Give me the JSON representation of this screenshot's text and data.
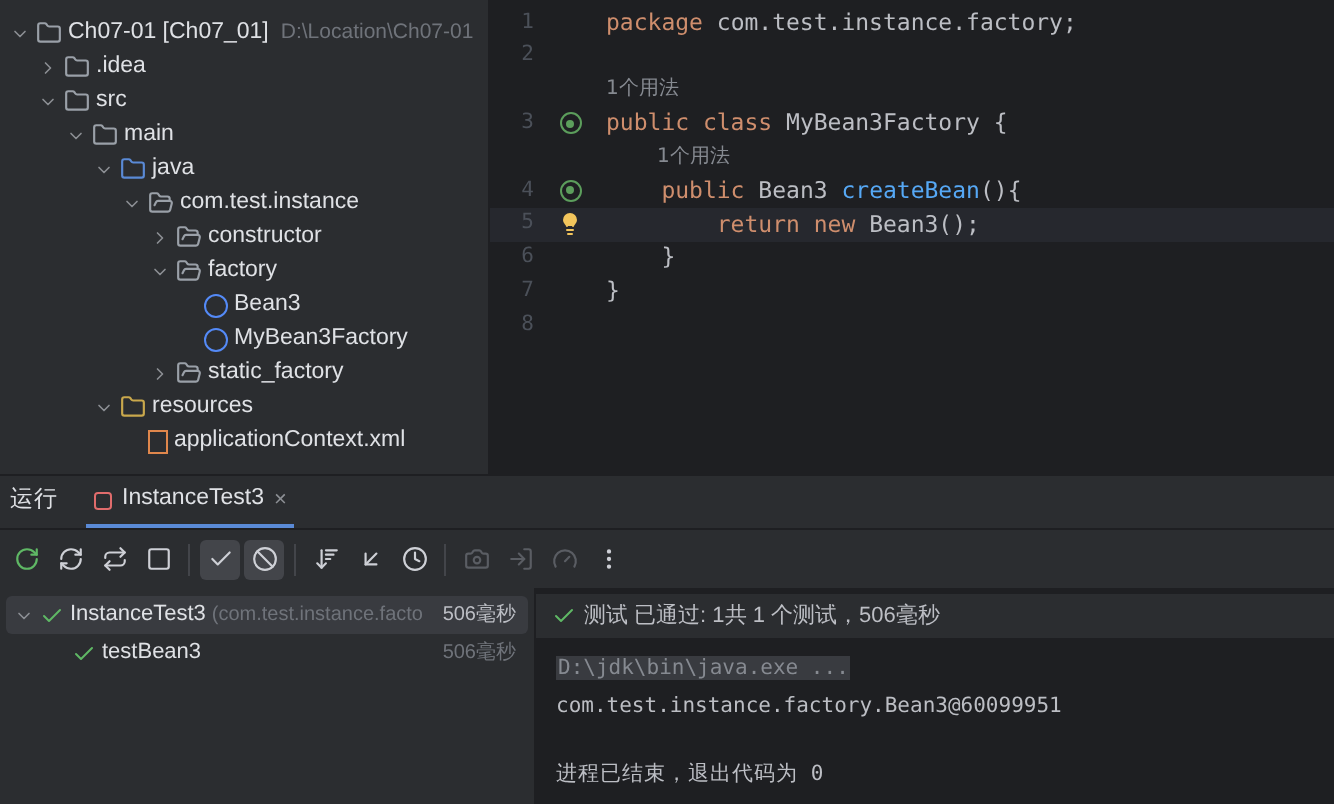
{
  "project_tree": {
    "items": [
      {
        "kind": "module",
        "label": "Ch07-01 [Ch07_01]",
        "path": "D:\\Location\\Ch07-01",
        "expanded": true,
        "children": [
          {
            "kind": "folder",
            "label": ".idea",
            "expanded": false
          },
          {
            "kind": "folder",
            "label": "src",
            "expanded": true,
            "children": [
              {
                "kind": "folder",
                "label": "main",
                "expanded": true,
                "children": [
                  {
                    "kind": "source",
                    "label": "java",
                    "expanded": true,
                    "children": [
                      {
                        "kind": "package",
                        "label": "com.test.instance",
                        "expanded": true,
                        "children": [
                          {
                            "kind": "package",
                            "label": "constructor",
                            "expanded": false
                          },
                          {
                            "kind": "package",
                            "label": "factory",
                            "expanded": true,
                            "children": [
                              {
                                "kind": "class",
                                "label": "Bean3"
                              },
                              {
                                "kind": "class",
                                "label": "MyBean3Factory"
                              }
                            ]
                          },
                          {
                            "kind": "package",
                            "label": "static_factory",
                            "expanded": false
                          }
                        ]
                      }
                    ]
                  },
                  {
                    "kind": "resources",
                    "label": "resources",
                    "expanded": true,
                    "children": [
                      {
                        "kind": "xml",
                        "label": "applicationContext.xml"
                      }
                    ]
                  }
                ]
              }
            ]
          }
        ]
      }
    ]
  },
  "editor": {
    "lines": [
      {
        "number": "1",
        "current": false,
        "tokens": [
          {
            "kind": "kw",
            "t": "package "
          },
          {
            "kind": "plain",
            "t": "com.test.instance.factory;"
          }
        ]
      },
      {
        "number": "2",
        "current": false
      },
      {
        "number": "3",
        "current": false,
        "hint": "1个用法",
        "gutter": {
          "kind": "bean"
        },
        "tokens": [
          {
            "kind": "kw",
            "t": "public class "
          },
          {
            "kind": "plain",
            "t": "MyBean3Factory {"
          }
        ]
      },
      {
        "number": "4",
        "current": false,
        "hint": "1个用法",
        "gutter": {
          "kind": "bean"
        },
        "tokens": [
          {
            "kind": "kw",
            "t": "    public "
          },
          {
            "kind": "plain",
            "t": "Bean3 "
          },
          {
            "kind": "method",
            "t": "createBean"
          },
          {
            "kind": "plain",
            "t": "(){"
          }
        ]
      },
      {
        "number": "5",
        "current": true,
        "gutter": {
          "kind": "bulb"
        },
        "tokens": [
          {
            "kind": "kw",
            "t": "        return new "
          },
          {
            "kind": "plain",
            "t": "Bean3();"
          }
        ]
      },
      {
        "number": "6",
        "current": false,
        "tokens": [
          {
            "kind": "plain",
            "t": "    }"
          }
        ]
      },
      {
        "number": "7",
        "current": false,
        "tokens": [
          {
            "kind": "plain",
            "t": "}"
          }
        ]
      },
      {
        "number": "8",
        "current": false
      }
    ]
  },
  "run_panel": {
    "title": "运行",
    "tabs": [
      {
        "label": "InstanceTest3",
        "selected": true,
        "close": "×"
      }
    ],
    "toolbar": [
      {
        "kind": "rerun",
        "on": false,
        "disabled": false
      },
      {
        "kind": "rerun-failed",
        "on": false,
        "disabled": false
      },
      {
        "kind": "auto-test",
        "on": false,
        "disabled": false
      },
      {
        "kind": "stop",
        "on": false,
        "disabled": false
      },
      {
        "kind": "sep"
      },
      {
        "kind": "show-passed",
        "on": true,
        "disabled": false
      },
      {
        "kind": "show-ignored",
        "on": true,
        "disabled": false
      },
      {
        "kind": "sep"
      },
      {
        "kind": "sort",
        "on": false,
        "disabled": false
      },
      {
        "kind": "collapse",
        "on": false,
        "disabled": false
      },
      {
        "kind": "history",
        "on": false,
        "disabled": false
      },
      {
        "kind": "sep"
      },
      {
        "kind": "camera",
        "on": false,
        "disabled": true
      },
      {
        "kind": "export",
        "on": false,
        "disabled": true
      },
      {
        "kind": "gauge",
        "on": false,
        "disabled": true
      },
      {
        "kind": "more",
        "on": false,
        "disabled": false
      }
    ],
    "tests": [
      {
        "name": "InstanceTest3",
        "detail": "(com.test.instance.facto",
        "time": "506毫秒",
        "selected": true,
        "expanded": true,
        "passed": true,
        "children": [
          {
            "name": "testBean3",
            "time": "506毫秒",
            "selected": false,
            "passed": true
          }
        ]
      }
    ],
    "status": {
      "passed": true,
      "text": "测试 已通过: 1共 1 个测试，506毫秒"
    },
    "console": [
      {
        "kind": "command",
        "text": "D:\\jdk\\bin\\java.exe ..."
      },
      {
        "kind": "output",
        "text": "com.test.instance.factory.Bean3@60099951"
      },
      {
        "kind": "blank"
      },
      {
        "kind": "output",
        "text": "进程已结束，退出代码为 0"
      }
    ]
  }
}
